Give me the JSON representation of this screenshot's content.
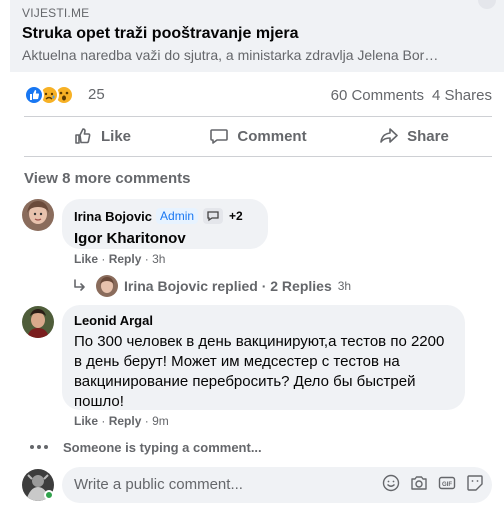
{
  "link": {
    "source": "VIJESTI.ME",
    "title": "Struka opet traži pooštravanje mjera",
    "description": "Aktuelna naredba važi do sjutra, a ministarka zdravlja Jelena Bor…"
  },
  "reactions": {
    "count": "25",
    "comments": "60 Comments",
    "shares": "4 Shares",
    "icons": [
      "like-icon",
      "sad-icon",
      "wow-icon"
    ]
  },
  "actions": {
    "like": "Like",
    "comment": "Comment",
    "share": "Share"
  },
  "view_more": "View 8 more comments",
  "comments": [
    {
      "author": "Irina Bojovic",
      "badge": "Admin",
      "extra": "+2",
      "text": "Igor Kharitonov",
      "like": "Like",
      "reply": "Reply",
      "time": "3h"
    },
    {
      "author": "Leonid Argal",
      "text": "По 300 человек в день вакцинируют,а тестов по 2200 в день берут! Может им медсестер с тестов на вакцинирование перебросить? Дело бы быстрей пошло!",
      "like": "Like",
      "reply": "Reply",
      "time": "9m"
    }
  ],
  "reply_thread": {
    "text": "Irina Bojovic replied · 2 Replies",
    "time": "3h"
  },
  "typing": "Someone is typing a comment...",
  "composer": {
    "placeholder": "Write a public comment..."
  },
  "colors": {
    "accent": "#1877f2",
    "muted": "#65676b",
    "bubble": "#f0f2f5",
    "online": "#31a24c"
  }
}
